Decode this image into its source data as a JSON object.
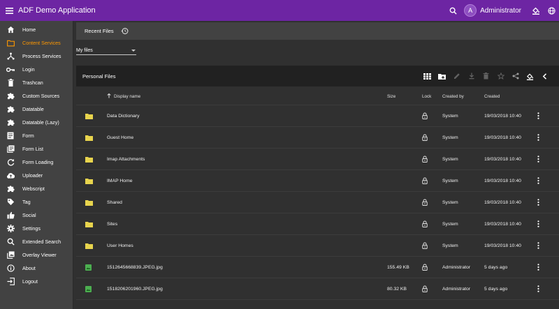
{
  "header": {
    "app_title": "ADF Demo Application",
    "user_initial": "A",
    "user_name": "Administrator",
    "accent_color": "#6d25a3"
  },
  "sidebar": {
    "items": [
      {
        "label": "Home",
        "icon": "home-icon",
        "active": false
      },
      {
        "label": "Content Services",
        "icon": "folder-icon",
        "active": true
      },
      {
        "label": "Process Services",
        "icon": "process-icon",
        "active": false
      },
      {
        "label": "Login",
        "icon": "key-icon",
        "active": false
      },
      {
        "label": "Trashcan",
        "icon": "trash-icon",
        "active": false
      },
      {
        "label": "Custom Sources",
        "icon": "puzzle-icon",
        "active": false
      },
      {
        "label": "Datatable",
        "icon": "puzzle-icon",
        "active": false
      },
      {
        "label": "Datatable (Lazy)",
        "icon": "puzzle-icon",
        "active": false
      },
      {
        "label": "Form",
        "icon": "form-icon",
        "active": false
      },
      {
        "label": "Form List",
        "icon": "form-list-icon",
        "active": false
      },
      {
        "label": "Form Loading",
        "icon": "refresh-icon",
        "active": false
      },
      {
        "label": "Uploader",
        "icon": "upload-icon",
        "active": false
      },
      {
        "label": "Webscript",
        "icon": "puzzle-icon",
        "active": false
      },
      {
        "label": "Tag",
        "icon": "tag-icon",
        "active": false
      },
      {
        "label": "Social",
        "icon": "thumb-up-icon",
        "active": false
      },
      {
        "label": "Settings",
        "icon": "gear-icon",
        "active": false
      },
      {
        "label": "Extended Search",
        "icon": "search-icon",
        "active": false
      },
      {
        "label": "Overlay Viewer",
        "icon": "overlay-icon",
        "active": false
      },
      {
        "label": "About",
        "icon": "info-icon",
        "active": false
      },
      {
        "label": "Logout",
        "icon": "logout-icon",
        "active": false
      }
    ],
    "active_color": "#ff9800"
  },
  "recent": {
    "label": "Recent Files"
  },
  "site_select": {
    "value": "My files"
  },
  "files": {
    "title": "Personal Files"
  },
  "table": {
    "columns": {
      "name": "Display name",
      "size": "Size",
      "lock": "Lock",
      "created_by": "Created by",
      "created": "Created"
    },
    "rows": [
      {
        "type": "folder",
        "name": "Data Dictionary",
        "size": "",
        "created_by": "System",
        "created": "19/03/2018 10:40"
      },
      {
        "type": "folder",
        "name": "Guest Home",
        "size": "",
        "created_by": "System",
        "created": "19/03/2018 10:40"
      },
      {
        "type": "folder",
        "name": "Imap Attachments",
        "size": "",
        "created_by": "System",
        "created": "19/03/2018 10:40"
      },
      {
        "type": "folder",
        "name": "IMAP Home",
        "size": "",
        "created_by": "System",
        "created": "19/03/2018 10:40"
      },
      {
        "type": "folder",
        "name": "Shared",
        "size": "",
        "created_by": "System",
        "created": "19/03/2018 10:40"
      },
      {
        "type": "folder",
        "name": "Sites",
        "size": "",
        "created_by": "System",
        "created": "19/03/2018 10:40"
      },
      {
        "type": "folder",
        "name": "User Homes",
        "size": "",
        "created_by": "System",
        "created": "19/03/2018 10:40"
      },
      {
        "type": "image",
        "name": "1512645668839.JPEG.jpg",
        "size": "155.49 KB",
        "created_by": "Administrator",
        "created": "5 days ago"
      },
      {
        "type": "image",
        "name": "1518206201960.JPEG.jpg",
        "size": "80.32 KB",
        "created_by": "Administrator",
        "created": "5 days ago"
      }
    ],
    "folder_color": "#e8d44d",
    "image_color": "#4caf50"
  }
}
